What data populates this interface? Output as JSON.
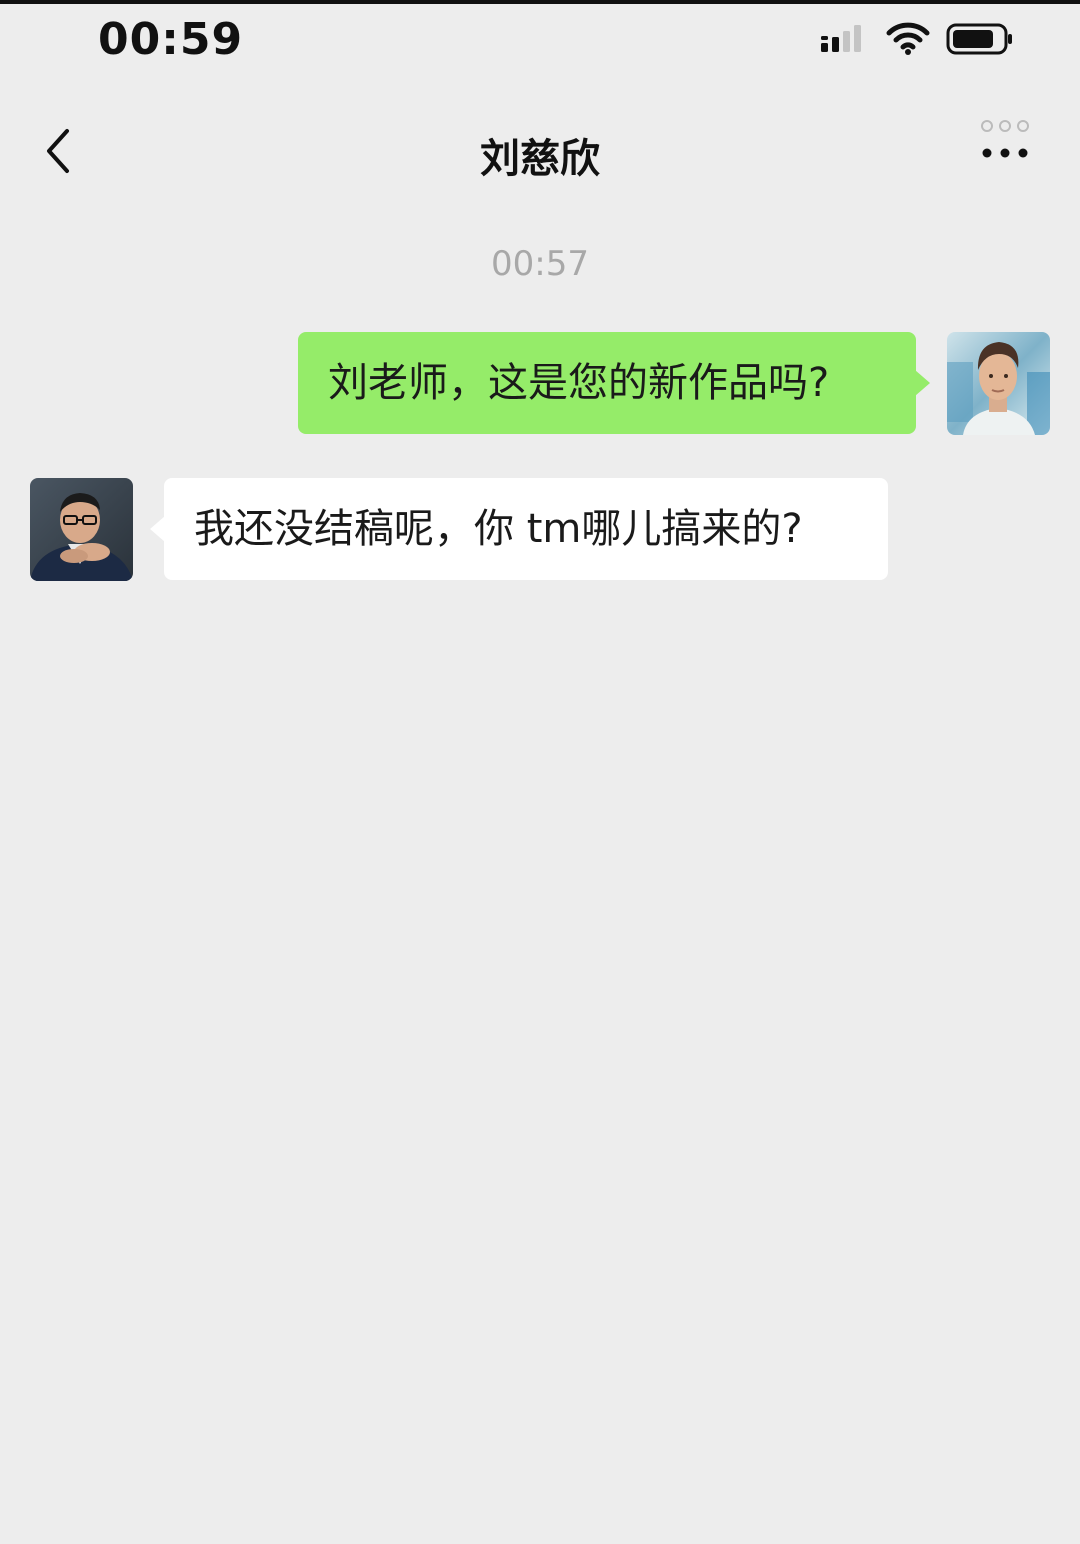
{
  "status_bar": {
    "time": "00:59",
    "icons": [
      "signal-icon",
      "wifi-icon",
      "battery-icon"
    ]
  },
  "nav": {
    "title": "刘慈欣",
    "back_icon": "chevron-left-icon",
    "more_icon": "more-dots-icon"
  },
  "chat": {
    "timestamp": "00:57",
    "messages": [
      {
        "direction": "outgoing",
        "text": "刘老师，这是您的新作品吗?",
        "bubble_color": "#95ec69"
      },
      {
        "direction": "incoming",
        "text": "我还没结稿呢，你 tm哪儿搞来的?",
        "bubble_color": "#ffffff"
      }
    ]
  },
  "colors": {
    "background": "#ededed",
    "outgoing_bubble": "#95ec69",
    "incoming_bubble": "#ffffff",
    "timestamp_text": "#a8a8a8"
  }
}
